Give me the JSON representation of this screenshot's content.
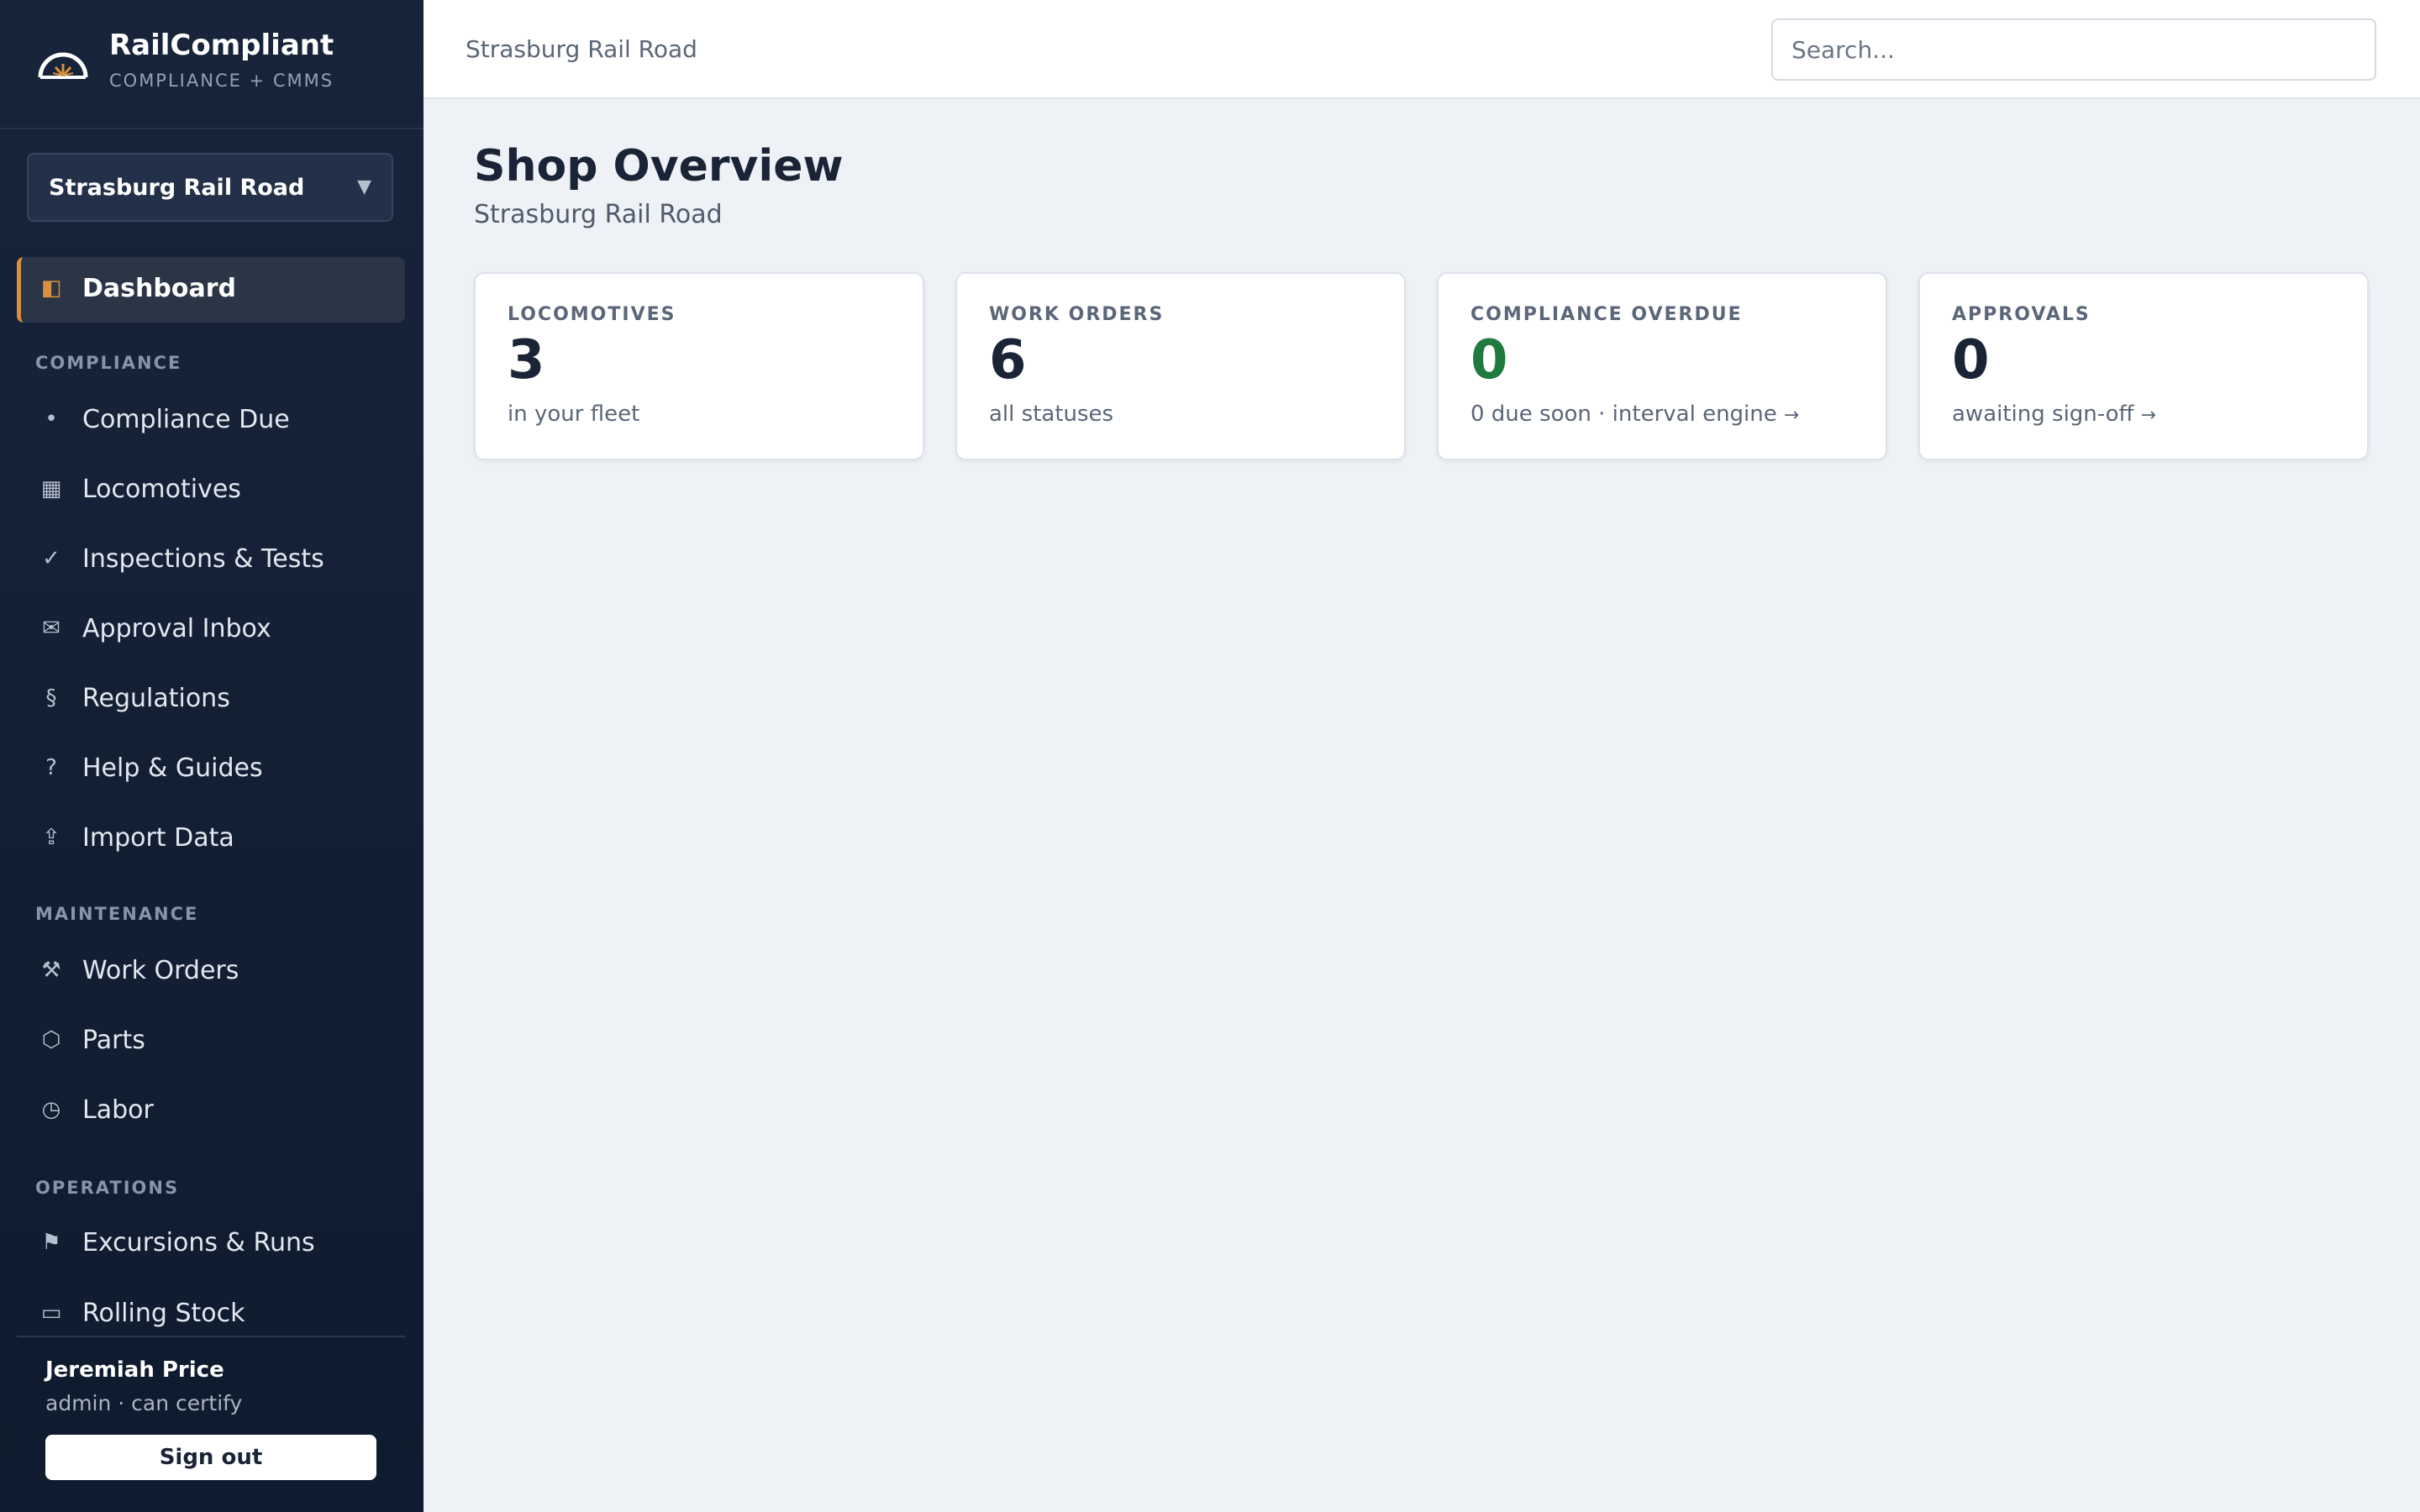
{
  "app": {
    "name": "RailCompliant",
    "tagline": "COMPLIANCE + CMMS"
  },
  "railroad_select": {
    "value": "Strasburg Rail Road"
  },
  "sidebar": {
    "dashboard": {
      "label": "Dashboard",
      "icon": "dashboard-icon"
    },
    "sections": {
      "compliance": "COMPLIANCE",
      "maintenance": "MAINTENANCE",
      "operations": "OPERATIONS"
    },
    "items": [
      {
        "label": "Compliance Due",
        "icon": "bullet-icon"
      },
      {
        "label": "Locomotives",
        "icon": "grid-icon"
      },
      {
        "label": "Inspections & Tests",
        "icon": "checkmark-icon"
      },
      {
        "label": "Approval Inbox",
        "icon": "envelope-icon"
      },
      {
        "label": "Regulations",
        "icon": "section-icon"
      },
      {
        "label": "Help & Guides",
        "icon": "question-icon"
      },
      {
        "label": "Import Data",
        "icon": "upload-icon"
      },
      {
        "label": "Work Orders",
        "icon": "hammer-pick-icon"
      },
      {
        "label": "Parts",
        "icon": "hexagon-icon"
      },
      {
        "label": "Labor",
        "icon": "clock-icon"
      },
      {
        "label": "Excursions & Runs",
        "icon": "flag-icon"
      },
      {
        "label": "Rolling Stock",
        "icon": "railcar-icon"
      }
    ]
  },
  "user": {
    "name": "Jeremiah Price",
    "role": "admin · can certify",
    "signout_label": "Sign out"
  },
  "topbar": {
    "breadcrumb": "Strasburg Rail Road",
    "search_placeholder": "Search..."
  },
  "main": {
    "title": "Shop Overview",
    "subtitle": "Strasburg Rail Road",
    "cards": [
      {
        "label": "LOCOMOTIVES",
        "value": "3",
        "note": "in your fleet"
      },
      {
        "label": "WORK ORDERS",
        "value": "6",
        "note": "all statuses"
      },
      {
        "label": "COMPLIANCE OVERDUE",
        "value": "0",
        "note": "0 due soon · interval engine",
        "arrow": "→"
      },
      {
        "label": "APPROVALS",
        "value": "0",
        "note": "awaiting sign-off",
        "arrow": "→"
      }
    ]
  },
  "colors": {
    "sidebar_bg": "#17243a",
    "accent": "#d98f3e",
    "good": "#1f7a3e",
    "page_bg": "#eef1f6"
  }
}
